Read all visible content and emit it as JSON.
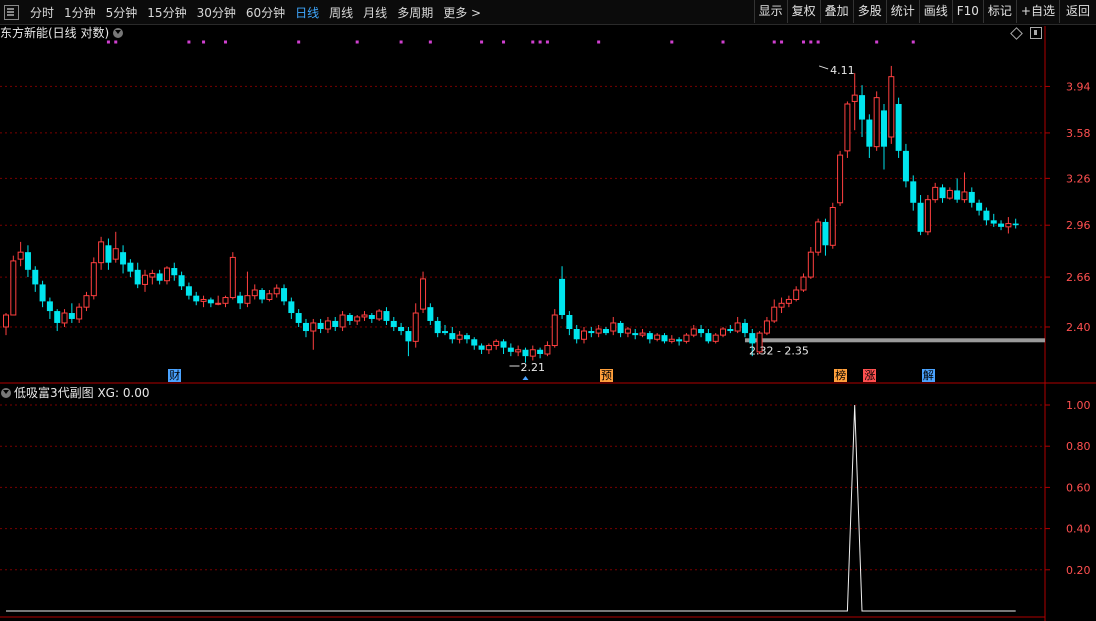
{
  "toolbar": {
    "periods": [
      "分时",
      "1分钟",
      "5分钟",
      "15分钟",
      "30分钟",
      "60分钟",
      "日线",
      "周线",
      "月线",
      "多周期",
      "更多 >"
    ],
    "active_period": "日线",
    "buttons": [
      "显示",
      "复权",
      "叠加",
      "多股",
      "统计",
      "画线",
      "F10",
      "标记",
      "+自选",
      "返回"
    ]
  },
  "main_title": "东方新能(日线 对数)",
  "sub_title": "低吸富3代副图 XG: 0.00",
  "colors": {
    "up": "#ff4040",
    "down": "#00e5ee",
    "grid": "#7a0000",
    "axis": "#ff5050",
    "marker": "#d040d0",
    "support": "#9a9a9a"
  },
  "chart_data": [
    {
      "type": "candlestick",
      "y_scale": "log",
      "ylim": [
        2.21,
        4.3
      ],
      "y_ticks": [
        "3.94",
        "3.58",
        "3.26",
        "2.96",
        "2.66",
        "2.40"
      ],
      "annotations": {
        "high_label": "4.11",
        "low_label": "2.21",
        "support_range": "2.32 - 2.35"
      },
      "badges": [
        {
          "label": "财",
          "bar": 23,
          "color": "#4aa3ff"
        },
        {
          "label": "预",
          "bar": 82,
          "color": "#ffa03c"
        },
        {
          "label": "榜",
          "bar": 114,
          "color": "#ffa03c"
        },
        {
          "label": "涨",
          "bar": 118,
          "color": "#ff5050"
        },
        {
          "label": "解",
          "bar": 126,
          "color": "#4aa3ff"
        }
      ],
      "marker_bars": [
        14,
        15,
        25,
        27,
        30,
        40,
        48,
        54,
        58,
        65,
        68,
        72,
        73,
        74,
        81,
        91,
        98,
        105,
        106,
        109,
        110,
        111,
        119,
        124
      ],
      "candles": [
        [
          2.4,
          2.46,
          2.47,
          2.36
        ],
        [
          2.46,
          2.75,
          2.78,
          2.46
        ],
        [
          2.76,
          2.8,
          2.86,
          2.72
        ],
        [
          2.8,
          2.7,
          2.84,
          2.66
        ],
        [
          2.7,
          2.62,
          2.72,
          2.58
        ],
        [
          2.62,
          2.53,
          2.64,
          2.5
        ],
        [
          2.53,
          2.48,
          2.55,
          2.44
        ],
        [
          2.48,
          2.42,
          2.49,
          2.38
        ],
        [
          2.42,
          2.47,
          2.49,
          2.4
        ],
        [
          2.47,
          2.44,
          2.52,
          2.42
        ],
        [
          2.44,
          2.5,
          2.52,
          2.42
        ],
        [
          2.5,
          2.56,
          2.58,
          2.48
        ],
        [
          2.56,
          2.74,
          2.77,
          2.54
        ],
        [
          2.74,
          2.86,
          2.89,
          2.7
        ],
        [
          2.84,
          2.74,
          2.88,
          2.7
        ],
        [
          2.76,
          2.82,
          2.92,
          2.74
        ],
        [
          2.8,
          2.73,
          2.84,
          2.68
        ],
        [
          2.74,
          2.69,
          2.76,
          2.66
        ],
        [
          2.7,
          2.62,
          2.74,
          2.6
        ],
        [
          2.62,
          2.67,
          2.7,
          2.58
        ],
        [
          2.66,
          2.68,
          2.7,
          2.62
        ],
        [
          2.68,
          2.64,
          2.7,
          2.62
        ],
        [
          2.64,
          2.71,
          2.72,
          2.62
        ],
        [
          2.71,
          2.67,
          2.74,
          2.64
        ],
        [
          2.67,
          2.61,
          2.69,
          2.59
        ],
        [
          2.61,
          2.56,
          2.63,
          2.54
        ],
        [
          2.56,
          2.53,
          2.58,
          2.51
        ],
        [
          2.53,
          2.54,
          2.56,
          2.5
        ],
        [
          2.54,
          2.52,
          2.55,
          2.5
        ],
        [
          2.52,
          2.52,
          2.56,
          2.51
        ],
        [
          2.52,
          2.55,
          2.56,
          2.5
        ],
        [
          2.55,
          2.77,
          2.8,
          2.54
        ],
        [
          2.56,
          2.52,
          2.58,
          2.49
        ],
        [
          2.52,
          2.56,
          2.69,
          2.5
        ],
        [
          2.56,
          2.59,
          2.62,
          2.54
        ],
        [
          2.59,
          2.54,
          2.6,
          2.52
        ],
        [
          2.54,
          2.57,
          2.59,
          2.53
        ],
        [
          2.57,
          2.6,
          2.62,
          2.55
        ],
        [
          2.6,
          2.53,
          2.62,
          2.51
        ],
        [
          2.53,
          2.47,
          2.55,
          2.44
        ],
        [
          2.47,
          2.42,
          2.49,
          2.4
        ],
        [
          2.42,
          2.38,
          2.44,
          2.35
        ],
        [
          2.38,
          2.42,
          2.44,
          2.29
        ],
        [
          2.42,
          2.39,
          2.44,
          2.37
        ],
        [
          2.39,
          2.43,
          2.45,
          2.37
        ],
        [
          2.43,
          2.4,
          2.45,
          2.38
        ],
        [
          2.4,
          2.46,
          2.48,
          2.38
        ],
        [
          2.46,
          2.43,
          2.47,
          2.41
        ],
        [
          2.43,
          2.45,
          2.46,
          2.41
        ],
        [
          2.45,
          2.46,
          2.48,
          2.43
        ],
        [
          2.46,
          2.44,
          2.47,
          2.42
        ],
        [
          2.44,
          2.48,
          2.49,
          2.43
        ],
        [
          2.48,
          2.43,
          2.5,
          2.41
        ],
        [
          2.43,
          2.4,
          2.45,
          2.38
        ],
        [
          2.4,
          2.38,
          2.42,
          2.36
        ],
        [
          2.38,
          2.33,
          2.4,
          2.26
        ],
        [
          2.33,
          2.47,
          2.52,
          2.3
        ],
        [
          2.49,
          2.65,
          2.69,
          2.47
        ],
        [
          2.5,
          2.43,
          2.52,
          2.41
        ],
        [
          2.43,
          2.37,
          2.45,
          2.35
        ],
        [
          2.38,
          2.37,
          2.41,
          2.36
        ],
        [
          2.37,
          2.34,
          2.4,
          2.32
        ],
        [
          2.34,
          2.36,
          2.38,
          2.32
        ],
        [
          2.36,
          2.34,
          2.37,
          2.32
        ],
        [
          2.34,
          2.31,
          2.35,
          2.29
        ],
        [
          2.31,
          2.29,
          2.32,
          2.27
        ],
        [
          2.29,
          2.31,
          2.32,
          2.27
        ],
        [
          2.31,
          2.33,
          2.34,
          2.29
        ],
        [
          2.33,
          2.3,
          2.34,
          2.27
        ],
        [
          2.3,
          2.28,
          2.32,
          2.26
        ],
        [
          2.28,
          2.29,
          2.31,
          2.26
        ],
        [
          2.29,
          2.26,
          2.3,
          2.23
        ],
        [
          2.26,
          2.29,
          2.31,
          2.24
        ],
        [
          2.29,
          2.27,
          2.3,
          2.25
        ],
        [
          2.27,
          2.31,
          2.33,
          2.26
        ],
        [
          2.31,
          2.46,
          2.49,
          2.3
        ],
        [
          2.65,
          2.46,
          2.72,
          2.44
        ],
        [
          2.46,
          2.39,
          2.48,
          2.36
        ],
        [
          2.39,
          2.34,
          2.41,
          2.32
        ],
        [
          2.34,
          2.38,
          2.4,
          2.32
        ],
        [
          2.38,
          2.37,
          2.4,
          2.35
        ],
        [
          2.37,
          2.39,
          2.41,
          2.35
        ],
        [
          2.39,
          2.37,
          2.4,
          2.36
        ],
        [
          2.38,
          2.42,
          2.45,
          2.36
        ],
        [
          2.42,
          2.37,
          2.43,
          2.35
        ],
        [
          2.37,
          2.39,
          2.4,
          2.35
        ],
        [
          2.37,
          2.36,
          2.39,
          2.34
        ],
        [
          2.36,
          2.37,
          2.39,
          2.35
        ],
        [
          2.37,
          2.34,
          2.38,
          2.32
        ],
        [
          2.34,
          2.36,
          2.37,
          2.33
        ],
        [
          2.36,
          2.33,
          2.37,
          2.32
        ],
        [
          2.33,
          2.34,
          2.36,
          2.32
        ],
        [
          2.34,
          2.33,
          2.35,
          2.31
        ],
        [
          2.33,
          2.36,
          2.37,
          2.32
        ],
        [
          2.36,
          2.39,
          2.41,
          2.35
        ],
        [
          2.39,
          2.37,
          2.41,
          2.35
        ],
        [
          2.37,
          2.33,
          2.39,
          2.32
        ],
        [
          2.33,
          2.36,
          2.37,
          2.32
        ],
        [
          2.36,
          2.39,
          2.4,
          2.35
        ],
        [
          2.39,
          2.38,
          2.41,
          2.37
        ],
        [
          2.38,
          2.42,
          2.45,
          2.37
        ],
        [
          2.42,
          2.37,
          2.44,
          2.35
        ],
        [
          2.37,
          2.32,
          2.39,
          2.26
        ],
        [
          2.28,
          2.37,
          2.38,
          2.27
        ],
        [
          2.37,
          2.43,
          2.45,
          2.36
        ],
        [
          2.43,
          2.5,
          2.54,
          2.42
        ],
        [
          2.5,
          2.52,
          2.55,
          2.47
        ],
        [
          2.52,
          2.54,
          2.56,
          2.5
        ],
        [
          2.54,
          2.59,
          2.61,
          2.53
        ],
        [
          2.59,
          2.66,
          2.68,
          2.58
        ],
        [
          2.66,
          2.8,
          2.83,
          2.65
        ],
        [
          2.8,
          2.98,
          3.0,
          2.78
        ],
        [
          2.98,
          2.84,
          3.0,
          2.78
        ],
        [
          2.84,
          3.07,
          3.1,
          2.82
        ],
        [
          3.1,
          3.42,
          3.45,
          3.08
        ],
        [
          3.45,
          3.8,
          3.82,
          3.4
        ],
        [
          3.82,
          3.87,
          4.05,
          3.6
        ],
        [
          3.87,
          3.68,
          3.95,
          3.55
        ],
        [
          3.68,
          3.48,
          3.72,
          3.4
        ],
        [
          3.48,
          3.85,
          3.9,
          3.45
        ],
        [
          3.75,
          3.48,
          3.8,
          3.32
        ],
        [
          3.55,
          4.02,
          4.11,
          3.5
        ],
        [
          3.8,
          3.45,
          3.85,
          3.4
        ],
        [
          3.45,
          3.24,
          3.5,
          3.2
        ],
        [
          3.24,
          3.1,
          3.28,
          3.05
        ],
        [
          3.1,
          2.92,
          3.15,
          2.9
        ],
        [
          2.92,
          3.12,
          3.15,
          2.9
        ],
        [
          3.12,
          3.2,
          3.23,
          3.1
        ],
        [
          3.2,
          3.13,
          3.22,
          3.1
        ],
        [
          3.13,
          3.18,
          3.2,
          3.12
        ],
        [
          3.18,
          3.12,
          3.26,
          3.1
        ],
        [
          3.12,
          3.17,
          3.3,
          3.1
        ],
        [
          3.17,
          3.1,
          3.2,
          3.07
        ],
        [
          3.1,
          3.05,
          3.12,
          3.02
        ],
        [
          3.05,
          2.99,
          3.07,
          2.96
        ],
        [
          2.99,
          2.97,
          3.03,
          2.95
        ],
        [
          2.97,
          2.95,
          2.99,
          2.93
        ],
        [
          2.95,
          2.97,
          3.01,
          2.91
        ],
        [
          2.97,
          2.96,
          3.0,
          2.94
        ]
      ]
    },
    {
      "type": "line",
      "series": [
        {
          "values_sparse": {
            "default": 0,
            "spike_index": 116,
            "spike_value": 1.0
          }
        }
      ],
      "ylim": [
        0,
        1.0
      ],
      "y_ticks": [
        "1.00",
        "0.80",
        "0.60",
        "0.40",
        "0.20"
      ]
    }
  ]
}
